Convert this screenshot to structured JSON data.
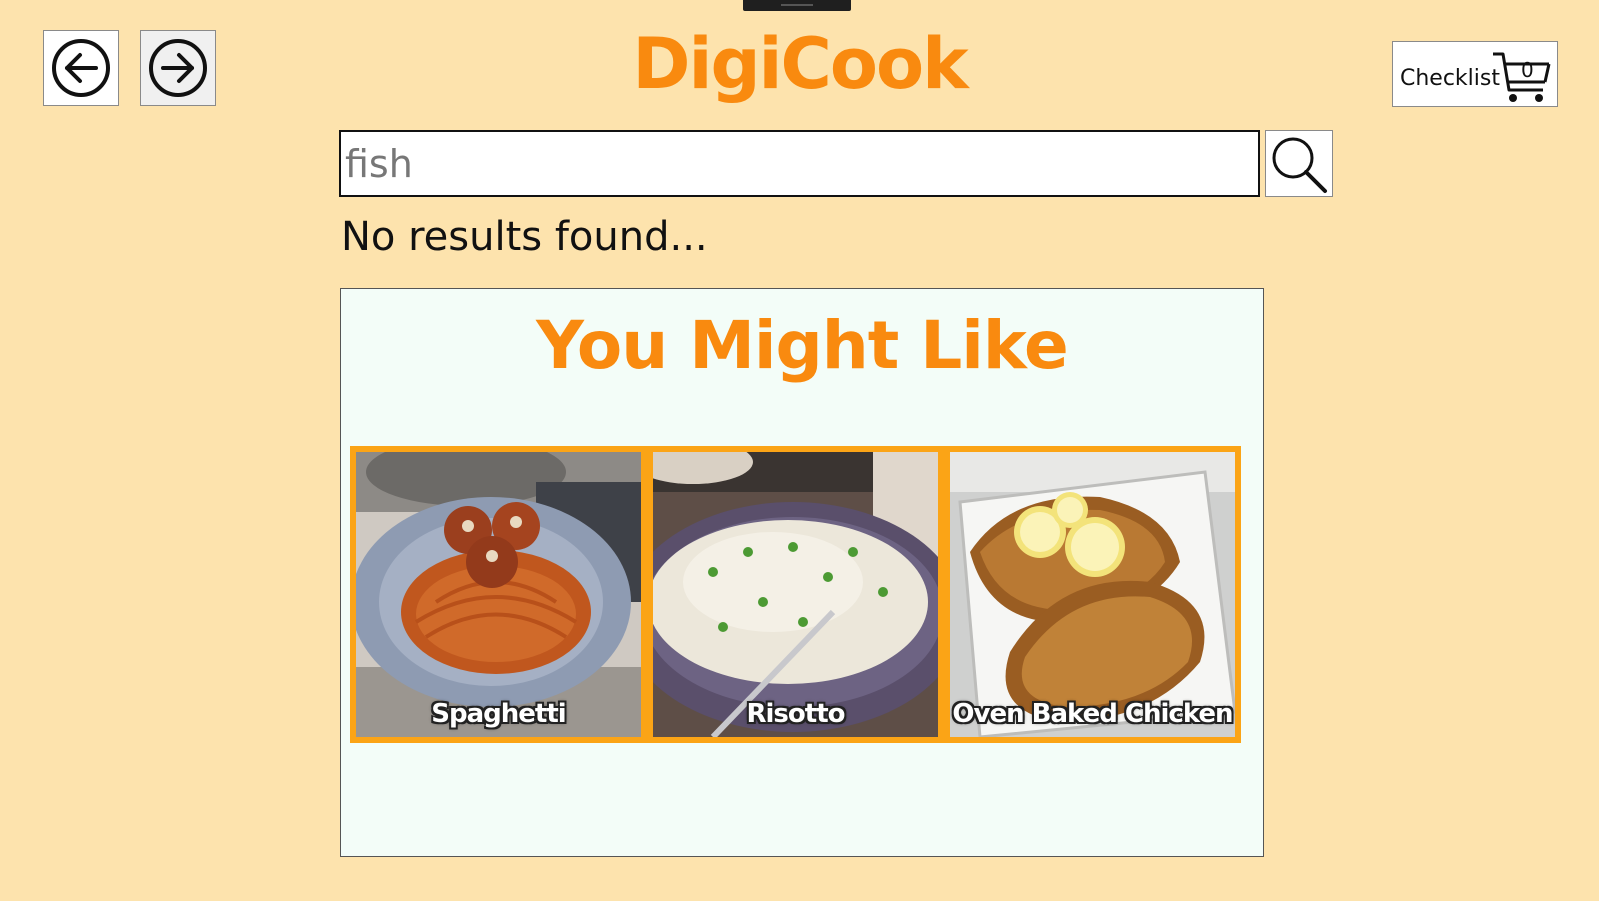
{
  "app": {
    "title": "DigiCook"
  },
  "nav": {
    "back_icon": "arrow-left-circle-icon",
    "forward_icon": "arrow-right-circle-icon"
  },
  "checklist": {
    "label": "Checklist",
    "count": "0",
    "icon": "cart-icon"
  },
  "search": {
    "value": "fish",
    "icon": "magnifier-icon"
  },
  "results": {
    "message": "No results found..."
  },
  "suggestions": {
    "heading": "You Might Like",
    "items": [
      {
        "label": "Spaghetti"
      },
      {
        "label": "Risotto"
      },
      {
        "label": "Oven Baked Chicken"
      }
    ]
  },
  "colors": {
    "background": "#fde3ad",
    "accent": "#f98a0f",
    "card_border": "#fba416",
    "panel": "#f3fdf8"
  }
}
